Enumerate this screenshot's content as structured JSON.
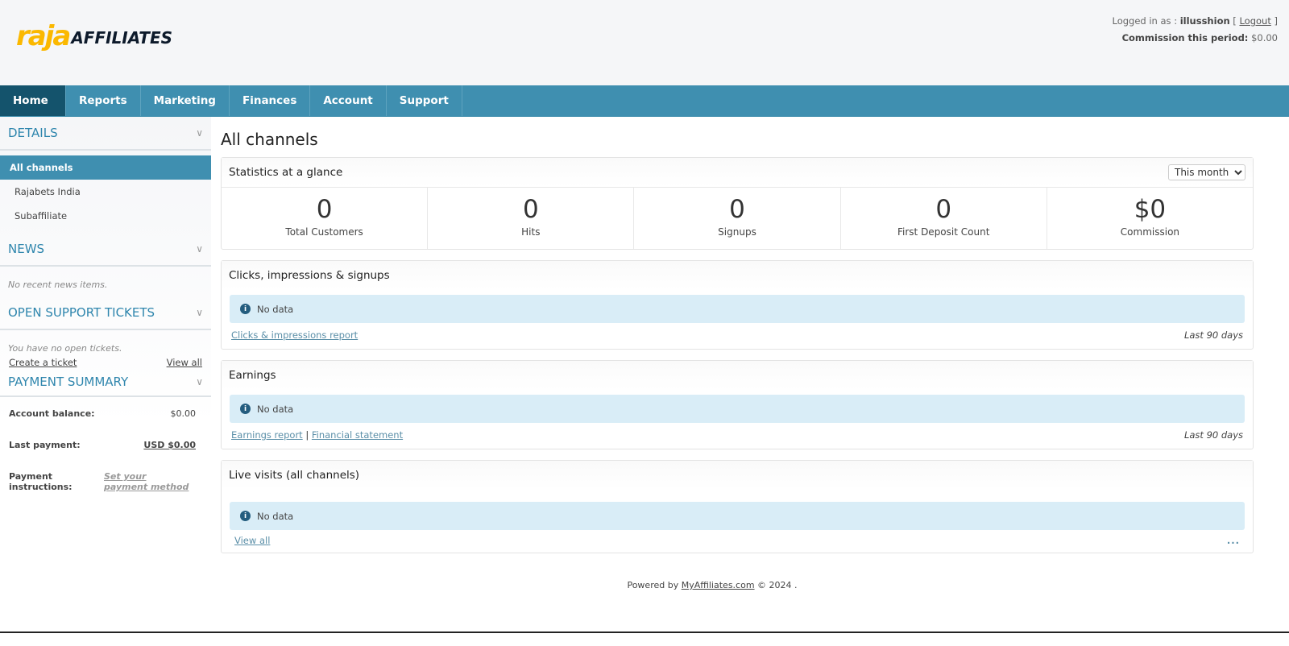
{
  "brand": {
    "logo_raja": "raja",
    "logo_affiliates": "AFFILIATES",
    "colors": {
      "yellow": "#fbb800",
      "nav": "#3f8fb0",
      "nav_active": "#14536c"
    }
  },
  "user": {
    "logged_in_label": "Logged in as :",
    "username": "illusshion",
    "logout": "Logout",
    "commission_label": "Commission this period:",
    "commission_value": "$0.00"
  },
  "nav": [
    "Home",
    "Reports",
    "Marketing",
    "Finances",
    "Account",
    "Support"
  ],
  "sidebar": {
    "details": {
      "title": "DETAILS",
      "items": [
        "All channels",
        "Rajabets India",
        "Subaffiliate"
      ]
    },
    "news": {
      "title": "NEWS",
      "empty": "No recent news items."
    },
    "tickets": {
      "title": "OPEN SUPPORT TICKETS",
      "empty": "You have no open tickets.",
      "create": "Create a ticket",
      "view_all": "View all"
    },
    "payment": {
      "title": "PAYMENT SUMMARY",
      "balance_label": "Account balance:",
      "balance_value": "$0.00",
      "last_label": "Last payment:",
      "last_value": "USD $0.00",
      "instr_label": "Payment instructions:",
      "instr_value": "Set your payment method"
    }
  },
  "main": {
    "title": "All channels",
    "stats": {
      "title": "Statistics at a glance",
      "period": "This month",
      "items": [
        {
          "value": "0",
          "label": "Total Customers"
        },
        {
          "value": "0",
          "label": "Hits"
        },
        {
          "value": "0",
          "label": "Signups"
        },
        {
          "value": "0",
          "label": "First Deposit Count"
        },
        {
          "value": "$0",
          "label": "Commission"
        }
      ]
    },
    "clicks": {
      "title": "Clicks, impressions & signups",
      "nodata": "No data",
      "link": "Clicks & impressions report",
      "range": "Last 90 days"
    },
    "earnings": {
      "title": "Earnings",
      "nodata": "No data",
      "link1": "Earnings report",
      "sep": "|",
      "link2": "Financial statement",
      "range": "Last 90 days"
    },
    "live": {
      "title": "Live visits (all channels)",
      "nodata": "No data",
      "link": "View all",
      "more": "..."
    }
  },
  "footer": {
    "prefix": "Powered by",
    "link": "MyAffiliates.com",
    "suffix": "© 2024 ."
  }
}
